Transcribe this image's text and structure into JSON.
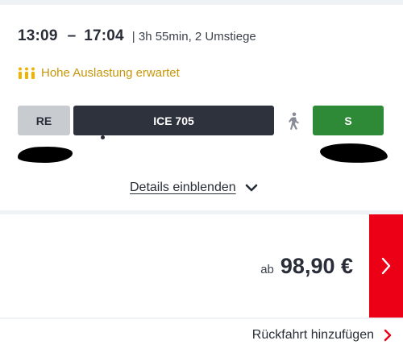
{
  "connection": {
    "departure": "13:09",
    "separator": "–",
    "arrival": "17:04",
    "meta": "| 3h 55min, 2 Umstiege"
  },
  "occupancy": {
    "text": "Hohe Auslastung erwartet",
    "icon": "occupancy-people-icon",
    "color": "#c7960a"
  },
  "segments": [
    {
      "label": "RE",
      "color": "#c8ccd0"
    },
    {
      "label": "ICE 705",
      "color": "#2e323c"
    },
    {
      "label": "S",
      "color": "#2e8a37"
    }
  ],
  "transfer_icon": "walking-icon",
  "details": {
    "label": "Details einblenden",
    "icon": "chevron-down-icon"
  },
  "price": {
    "prefix": "ab",
    "value": "98,90 €"
  },
  "buy_button": {
    "icon": "chevron-right-icon",
    "color": "#ec0016"
  },
  "return_trip": {
    "label": "Rückfahrt hinzufügen",
    "icon": "chevron-right-icon"
  }
}
